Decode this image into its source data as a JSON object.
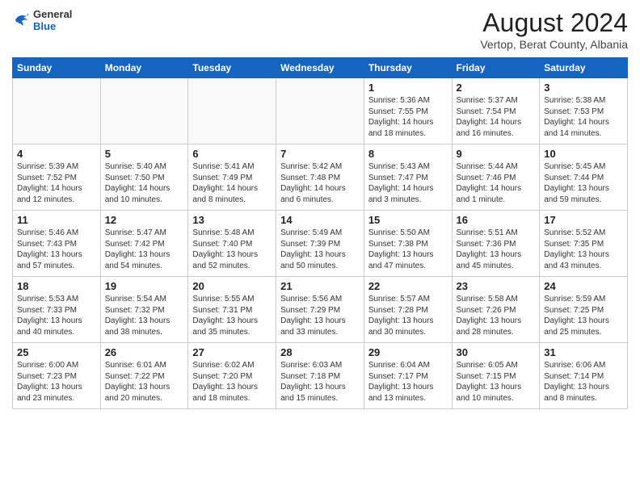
{
  "header": {
    "logo_general": "General",
    "logo_blue": "Blue",
    "month_title": "August 2024",
    "subtitle": "Vertop, Berat County, Albania"
  },
  "days_of_week": [
    "Sunday",
    "Monday",
    "Tuesday",
    "Wednesday",
    "Thursday",
    "Friday",
    "Saturday"
  ],
  "weeks": [
    [
      {
        "num": "",
        "info": ""
      },
      {
        "num": "",
        "info": ""
      },
      {
        "num": "",
        "info": ""
      },
      {
        "num": "",
        "info": ""
      },
      {
        "num": "1",
        "info": "Sunrise: 5:36 AM\nSunset: 7:55 PM\nDaylight: 14 hours\nand 18 minutes."
      },
      {
        "num": "2",
        "info": "Sunrise: 5:37 AM\nSunset: 7:54 PM\nDaylight: 14 hours\nand 16 minutes."
      },
      {
        "num": "3",
        "info": "Sunrise: 5:38 AM\nSunset: 7:53 PM\nDaylight: 14 hours\nand 14 minutes."
      }
    ],
    [
      {
        "num": "4",
        "info": "Sunrise: 5:39 AM\nSunset: 7:52 PM\nDaylight: 14 hours\nand 12 minutes."
      },
      {
        "num": "5",
        "info": "Sunrise: 5:40 AM\nSunset: 7:50 PM\nDaylight: 14 hours\nand 10 minutes."
      },
      {
        "num": "6",
        "info": "Sunrise: 5:41 AM\nSunset: 7:49 PM\nDaylight: 14 hours\nand 8 minutes."
      },
      {
        "num": "7",
        "info": "Sunrise: 5:42 AM\nSunset: 7:48 PM\nDaylight: 14 hours\nand 6 minutes."
      },
      {
        "num": "8",
        "info": "Sunrise: 5:43 AM\nSunset: 7:47 PM\nDaylight: 14 hours\nand 3 minutes."
      },
      {
        "num": "9",
        "info": "Sunrise: 5:44 AM\nSunset: 7:46 PM\nDaylight: 14 hours\nand 1 minute."
      },
      {
        "num": "10",
        "info": "Sunrise: 5:45 AM\nSunset: 7:44 PM\nDaylight: 13 hours\nand 59 minutes."
      }
    ],
    [
      {
        "num": "11",
        "info": "Sunrise: 5:46 AM\nSunset: 7:43 PM\nDaylight: 13 hours\nand 57 minutes."
      },
      {
        "num": "12",
        "info": "Sunrise: 5:47 AM\nSunset: 7:42 PM\nDaylight: 13 hours\nand 54 minutes."
      },
      {
        "num": "13",
        "info": "Sunrise: 5:48 AM\nSunset: 7:40 PM\nDaylight: 13 hours\nand 52 minutes."
      },
      {
        "num": "14",
        "info": "Sunrise: 5:49 AM\nSunset: 7:39 PM\nDaylight: 13 hours\nand 50 minutes."
      },
      {
        "num": "15",
        "info": "Sunrise: 5:50 AM\nSunset: 7:38 PM\nDaylight: 13 hours\nand 47 minutes."
      },
      {
        "num": "16",
        "info": "Sunrise: 5:51 AM\nSunset: 7:36 PM\nDaylight: 13 hours\nand 45 minutes."
      },
      {
        "num": "17",
        "info": "Sunrise: 5:52 AM\nSunset: 7:35 PM\nDaylight: 13 hours\nand 43 minutes."
      }
    ],
    [
      {
        "num": "18",
        "info": "Sunrise: 5:53 AM\nSunset: 7:33 PM\nDaylight: 13 hours\nand 40 minutes."
      },
      {
        "num": "19",
        "info": "Sunrise: 5:54 AM\nSunset: 7:32 PM\nDaylight: 13 hours\nand 38 minutes."
      },
      {
        "num": "20",
        "info": "Sunrise: 5:55 AM\nSunset: 7:31 PM\nDaylight: 13 hours\nand 35 minutes."
      },
      {
        "num": "21",
        "info": "Sunrise: 5:56 AM\nSunset: 7:29 PM\nDaylight: 13 hours\nand 33 minutes."
      },
      {
        "num": "22",
        "info": "Sunrise: 5:57 AM\nSunset: 7:28 PM\nDaylight: 13 hours\nand 30 minutes."
      },
      {
        "num": "23",
        "info": "Sunrise: 5:58 AM\nSunset: 7:26 PM\nDaylight: 13 hours\nand 28 minutes."
      },
      {
        "num": "24",
        "info": "Sunrise: 5:59 AM\nSunset: 7:25 PM\nDaylight: 13 hours\nand 25 minutes."
      }
    ],
    [
      {
        "num": "25",
        "info": "Sunrise: 6:00 AM\nSunset: 7:23 PM\nDaylight: 13 hours\nand 23 minutes."
      },
      {
        "num": "26",
        "info": "Sunrise: 6:01 AM\nSunset: 7:22 PM\nDaylight: 13 hours\nand 20 minutes."
      },
      {
        "num": "27",
        "info": "Sunrise: 6:02 AM\nSunset: 7:20 PM\nDaylight: 13 hours\nand 18 minutes."
      },
      {
        "num": "28",
        "info": "Sunrise: 6:03 AM\nSunset: 7:18 PM\nDaylight: 13 hours\nand 15 minutes."
      },
      {
        "num": "29",
        "info": "Sunrise: 6:04 AM\nSunset: 7:17 PM\nDaylight: 13 hours\nand 13 minutes."
      },
      {
        "num": "30",
        "info": "Sunrise: 6:05 AM\nSunset: 7:15 PM\nDaylight: 13 hours\nand 10 minutes."
      },
      {
        "num": "31",
        "info": "Sunrise: 6:06 AM\nSunset: 7:14 PM\nDaylight: 13 hours\nand 8 minutes."
      }
    ]
  ]
}
